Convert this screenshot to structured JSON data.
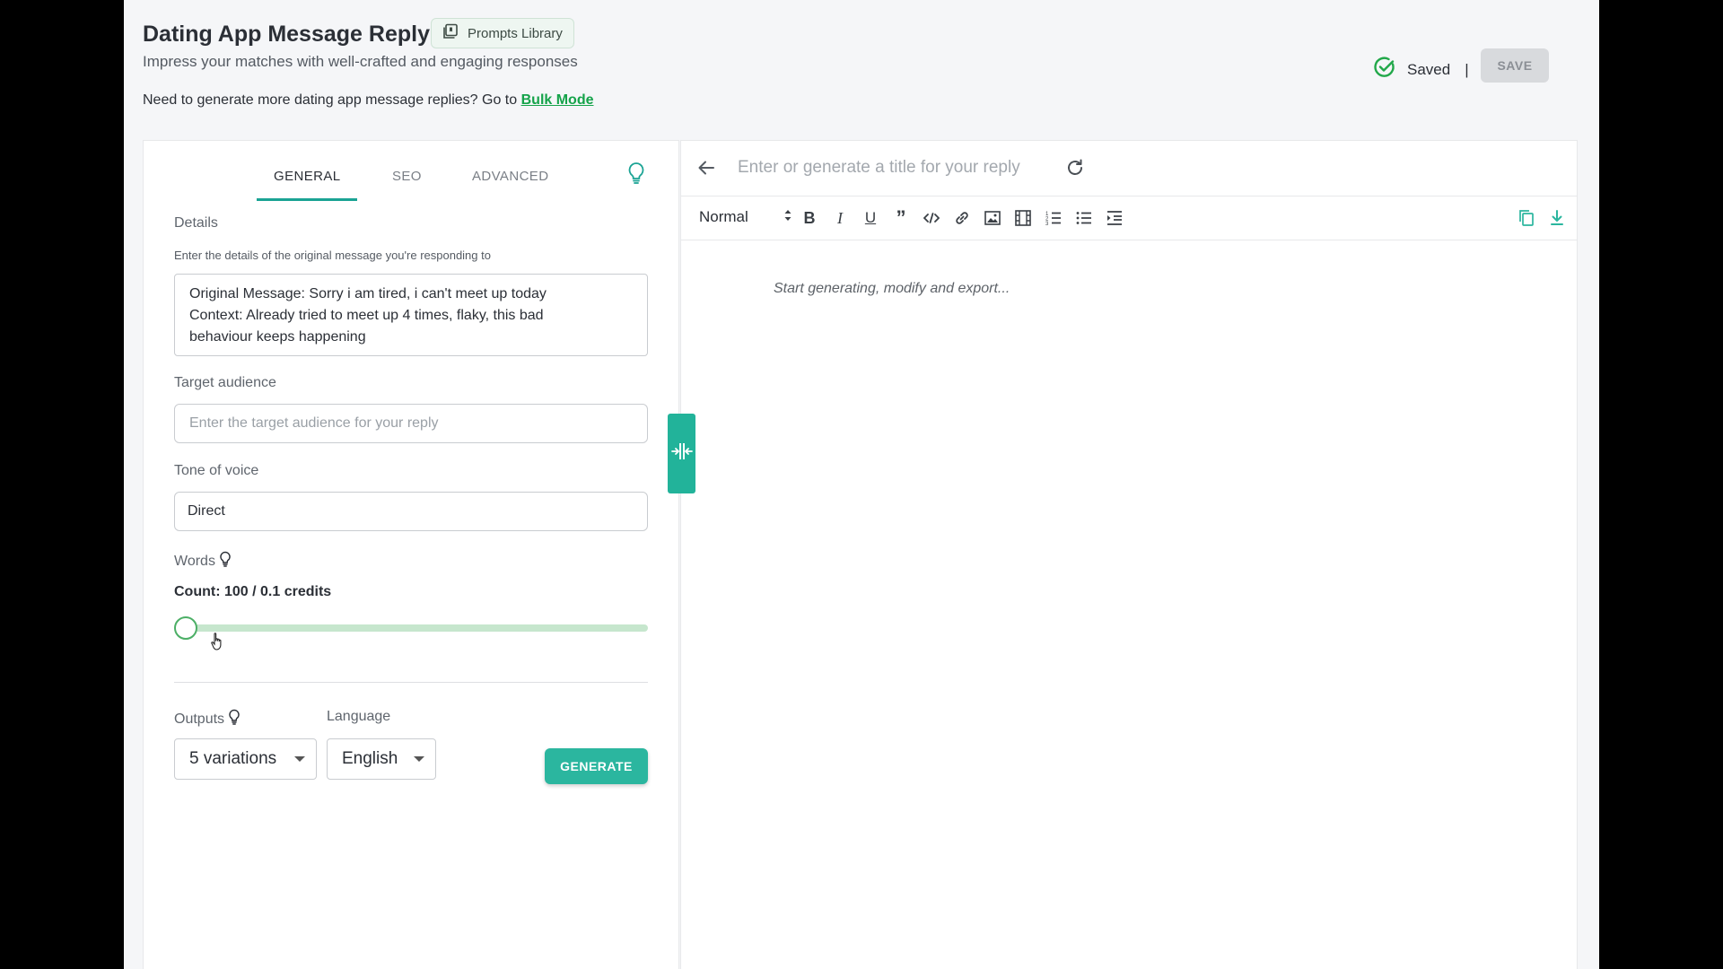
{
  "header": {
    "title": "Dating App Message Reply",
    "prompts_library_label": "Prompts Library",
    "subtitle": "Impress your matches with well-crafted and engaging responses",
    "bulk_text": "Need to generate more dating app message replies? Go to",
    "bulk_link": "Bulk Mode",
    "saved_label": "Saved",
    "separator": "|",
    "save_button": "SAVE"
  },
  "tabs": [
    {
      "label": "GENERAL",
      "active": true
    },
    {
      "label": "SEO",
      "active": false
    },
    {
      "label": "ADVANCED",
      "active": false
    }
  ],
  "form": {
    "details_label": "Details",
    "details_help": "Enter the details of the original message you're responding to",
    "details_value_line1": "Original Message: Sorry i am tired, i can't meet up today",
    "details_value_line2": "Context: Already tried to meet up 4 times, flaky, this bad",
    "details_value_line3": "behaviour keeps happening",
    "audience_label": "Target audience",
    "audience_placeholder": "Enter the target audience for your reply",
    "tone_label": "Tone of voice",
    "tone_value": "Direct",
    "words_label": "Words",
    "count_text": "Count: 100 / 0.1 credits",
    "slider_value": 0,
    "outputs_label": "Outputs",
    "outputs_value": "5 variations",
    "language_label": "Language",
    "language_value": "English",
    "generate_button": "GENERATE"
  },
  "editor": {
    "title_placeholder": "Enter or generate a title for your reply",
    "format_select": "Normal",
    "toolbar_icons": [
      "bold-icon",
      "italic-icon",
      "underline-icon",
      "quote-icon",
      "code-icon",
      "link-icon",
      "image-icon",
      "video-icon",
      "ordered-list-icon",
      "bullet-list-icon",
      "indent-icon"
    ],
    "placeholder": "Start generating, modify and export..."
  },
  "colors": {
    "accent": "#2bb69f",
    "link": "#15a34a",
    "slider_track": "#c6e6cd"
  }
}
